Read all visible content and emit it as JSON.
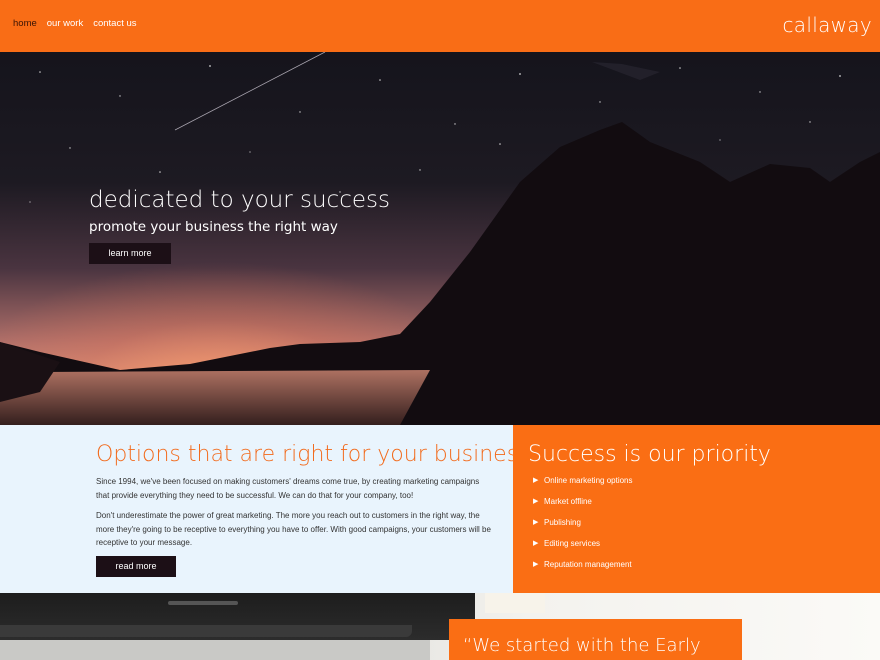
{
  "nav": {
    "items": [
      {
        "label": "home"
      },
      {
        "label": "our work"
      },
      {
        "label": "contact us"
      }
    ],
    "brand": "callaway"
  },
  "hero": {
    "title": "dedicated to your success",
    "subtitle": "promote your business the right way",
    "button": "learn more"
  },
  "options": {
    "heading": "Options that are right for your business",
    "paragraph1": "Since 1994, we've been focused on making customers' dreams come true, by creating marketing campaigns that provide everything they need to be successful. We can do that for your company, too!",
    "paragraph2": "Don't underestimate the power of great marketing. The more you reach out to customers in the right way, the more they're going to be receptive to everything you have to offer. With good campaigns, your customers will be receptive to your message.",
    "button": "read more"
  },
  "priority": {
    "heading": "Success is our priority",
    "items": [
      "Online marketing options",
      "Market offline",
      "Publishing",
      "Editing services",
      "Reputation management"
    ],
    "bullet": "▶"
  },
  "testimonial": {
    "quote": "“We started with the Early"
  },
  "colors": {
    "accent": "#f96d16",
    "dark_button": "#1c0f16",
    "options_bg": "#e9f4fd"
  }
}
